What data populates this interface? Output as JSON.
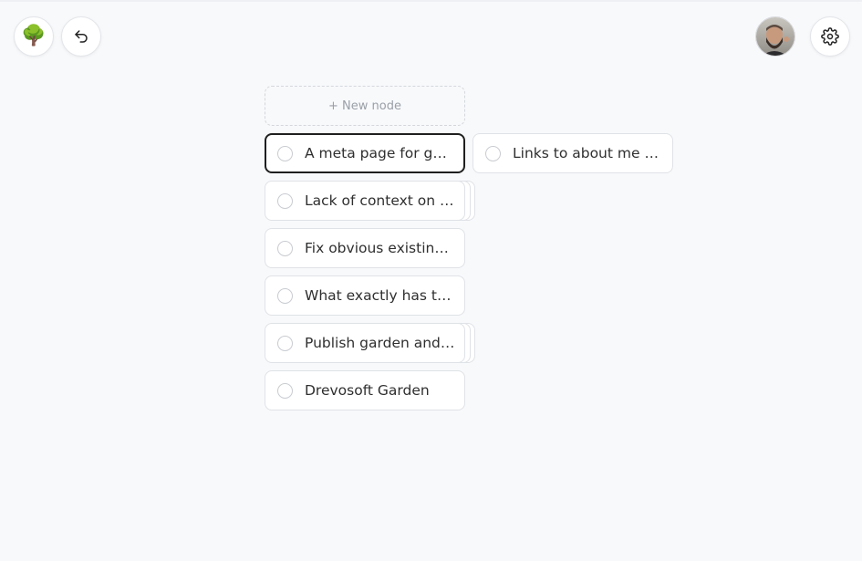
{
  "toolbar": {
    "tree_glyph": "🌳",
    "back_icon": "undo-arrow-icon",
    "settings_icon": "gear-icon"
  },
  "new_node": {
    "label": "+ New node"
  },
  "nodes": [
    {
      "label": "A meta page for gar…",
      "selected": true
    },
    {
      "label": "Links to about me pa…",
      "selected": false
    },
    {
      "label": "Lack of context on t…",
      "selected": false,
      "stacked": true
    },
    {
      "label": "Fix obvious existing …",
      "selected": false
    },
    {
      "label": "What exactly has to …",
      "selected": false
    },
    {
      "label": "Publish garden and u…",
      "selected": false,
      "stacked": true
    },
    {
      "label": "Drevosoft Garden",
      "selected": false
    }
  ],
  "colors": {
    "background": "#f8f9fb",
    "selected_border": "#1f1f1f",
    "node_border": "#dfe2e6"
  }
}
